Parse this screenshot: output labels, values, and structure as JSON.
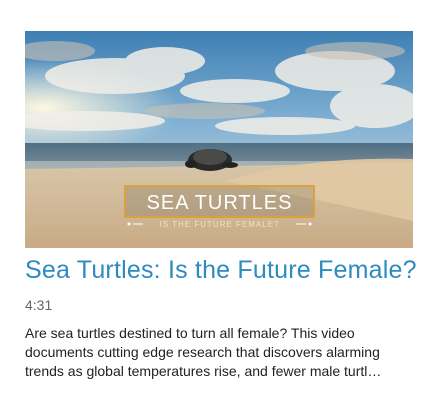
{
  "video": {
    "thumbnail": {
      "overlay_title": "SEA TURTLES",
      "overlay_subtitle": "IS THE FUTURE FEMALE?",
      "frame_color": "#d9a23a"
    },
    "title": "Sea Turtles: Is the Future Female?",
    "duration": "4:31",
    "description_lines": [
      "Are sea turtles destined to turn all female? This video",
      "documents cutting edge research that discovers alarming",
      "trends as global temperatures rise, and fewer male turtl…"
    ]
  },
  "colors": {
    "title_link": "#2d8bc0",
    "duration_text": "#666666",
    "description_text": "#222222"
  }
}
